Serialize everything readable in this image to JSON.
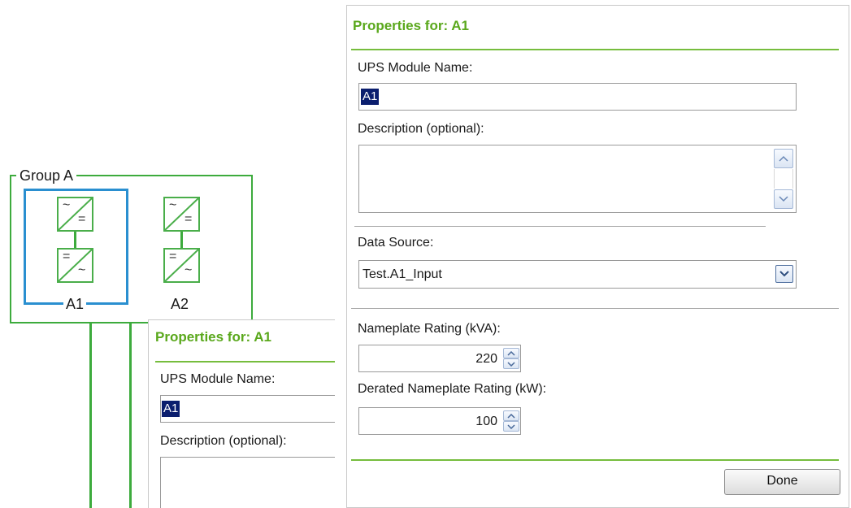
{
  "diagram": {
    "group_label": "Group A",
    "modules": [
      {
        "label": "A1",
        "top_symbol_left": "~",
        "top_symbol_right": "=",
        "bottom_symbol_left": "=",
        "bottom_symbol_right": "~"
      },
      {
        "label": "A2",
        "top_symbol_left": "~",
        "top_symbol_right": "=",
        "bottom_symbol_left": "=",
        "bottom_symbol_right": "~"
      }
    ]
  },
  "small_panel": {
    "title": "Properties for: A1",
    "name_label": "UPS Module Name:",
    "name_value": "A1",
    "description_label": "Description (optional):"
  },
  "panel": {
    "title": "Properties for: A1",
    "name_label": "UPS Module Name:",
    "name_value": "A1",
    "description_label": "Description (optional):",
    "description_value": "",
    "data_source_label": "Data Source:",
    "data_source_value": "Test.A1_Input",
    "nameplate_label": "Nameplate Rating (kVA):",
    "nameplate_value": "220",
    "derated_label": "Derated Nameplate Rating (kW):",
    "derated_value": "100",
    "done_label": "Done"
  },
  "colors": {
    "accent_green": "#5aa81c",
    "selection_blue": "#0b1e6e",
    "diagram_green": "#3dab3d",
    "selected_module_blue": "#2a8fd0"
  }
}
